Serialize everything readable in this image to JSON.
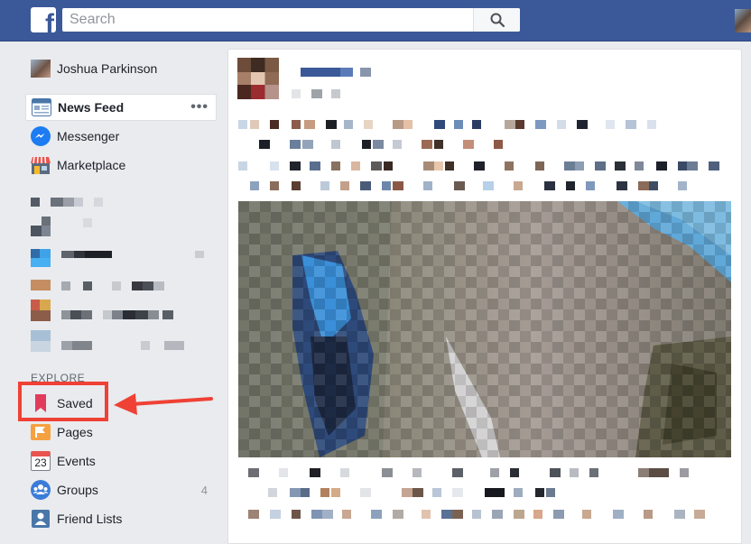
{
  "topbar": {
    "search_placeholder": "Search",
    "brand_color": "#3b5998",
    "logo_icon": "facebook-f-icon",
    "search_icon": "search-icon"
  },
  "sidebar": {
    "profile_name": "Joshua Parkinson",
    "items": [
      {
        "label": "News Feed",
        "icon": "news-feed-icon",
        "active": true
      },
      {
        "label": "Messenger",
        "icon": "messenger-icon"
      },
      {
        "label": "Marketplace",
        "icon": "marketplace-icon"
      }
    ],
    "explore_header": "EXPLORE",
    "explore_items": [
      {
        "label": "Saved",
        "icon": "bookmark-icon"
      },
      {
        "label": "Pages",
        "icon": "flag-icon"
      },
      {
        "label": "Events",
        "icon": "calendar-icon",
        "icon_text": "23"
      },
      {
        "label": "Groups",
        "icon": "groups-icon",
        "count": "4"
      },
      {
        "label": "Friend Lists",
        "icon": "friend-list-icon"
      }
    ],
    "more_label": "•••"
  },
  "annotation": {
    "highlight_color": "#ef4135"
  }
}
